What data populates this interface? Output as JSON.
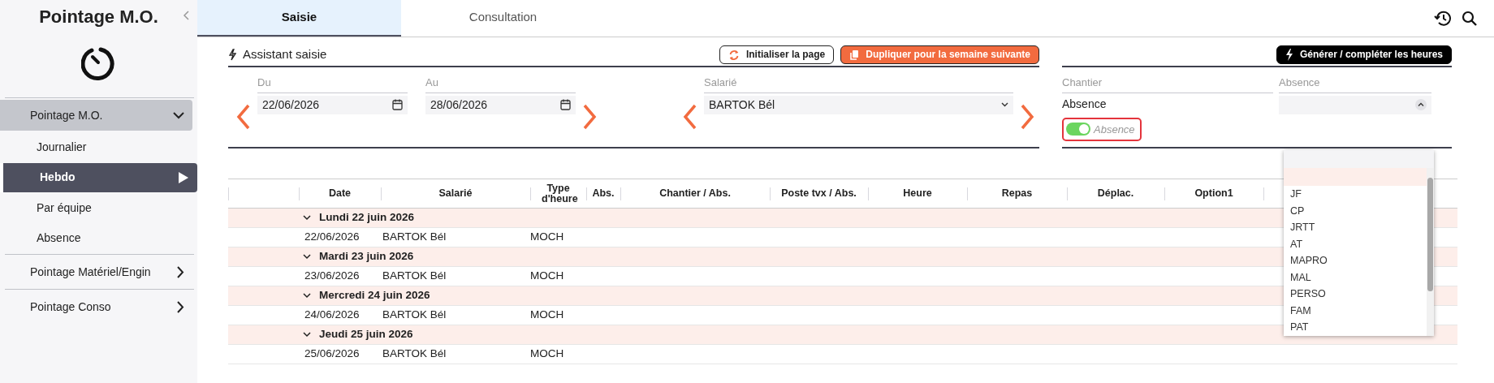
{
  "app": {
    "title": "Pointage M.O."
  },
  "sidebar": {
    "items": [
      {
        "label": "Pointage M.O.",
        "expanded": true,
        "children": [
          {
            "label": "Journalier",
            "selected": false
          },
          {
            "label": "Hebdo",
            "selected": true
          },
          {
            "label": "Par équipe",
            "selected": false
          },
          {
            "label": "Absence",
            "selected": false
          }
        ]
      },
      {
        "label": "Pointage Matériel/Engin",
        "expanded": false
      },
      {
        "label": "Pointage Conso",
        "expanded": false
      }
    ]
  },
  "tabs": [
    {
      "label": "Saisie",
      "selected": true
    },
    {
      "label": "Consultation",
      "selected": false
    }
  ],
  "assistant": {
    "title": "Assistant saisie",
    "buttons": [
      {
        "label": "Initialiser la page",
        "kind": "outline"
      },
      {
        "label": "Dupliquer pour la semaine suivante",
        "kind": "primary"
      }
    ],
    "date_from": {
      "label": "Du",
      "value": "22/06/2026"
    },
    "date_to": {
      "label": "Au",
      "value": "28/06/2026"
    },
    "employee": {
      "label": "Salarié",
      "value": "BARTOK Bél"
    }
  },
  "generate_panel": {
    "button": "Générer / compléter les heures",
    "site": {
      "label": "Chantier",
      "value": "Absence"
    },
    "absence_switch": {
      "label": "Absence",
      "on": true
    },
    "absence": {
      "label": "Absence",
      "dropdown": {
        "expanded": true,
        "blank_highlighted": true,
        "options": [
          "JF",
          "CP",
          "JRTT",
          "AT",
          "MAPRO",
          "MAL",
          "PERSO",
          "FAM",
          "PAT"
        ]
      }
    }
  },
  "table": {
    "columns": [
      "Date",
      "Salarié",
      "Type d'heure",
      "Abs.",
      "Chantier / Abs.",
      "Poste tvx / Abs.",
      "Heure",
      "Repas",
      "Déplac.",
      "Option1"
    ],
    "groups": [
      {
        "label": "Lundi 22 juin 2026",
        "expanded": true,
        "rows": [
          {
            "date": "22/06/2026",
            "employee": "BARTOK Bél",
            "hour_type": "MOCH"
          }
        ]
      },
      {
        "label": "Mardi 23 juin 2026",
        "expanded": true,
        "rows": [
          {
            "date": "23/06/2026",
            "employee": "BARTOK Bél",
            "hour_type": "MOCH"
          }
        ]
      },
      {
        "label": "Mercredi 24 juin 2026",
        "expanded": true,
        "rows": [
          {
            "date": "24/06/2026",
            "employee": "BARTOK Bél",
            "hour_type": "MOCH"
          }
        ]
      },
      {
        "label": "Jeudi 25 juin 2026",
        "expanded": true,
        "rows": [
          {
            "date": "25/06/2026",
            "employee": "BARTOK Bél",
            "hour_type": "MOCH"
          }
        ]
      }
    ]
  }
}
